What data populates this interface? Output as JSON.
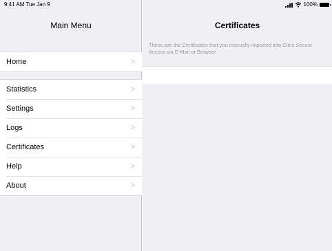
{
  "status_bar": {
    "time": "9:41 AM",
    "date": "Tue Jan 9",
    "wifi_icon": "wifi-icon",
    "battery": "100%"
  },
  "master": {
    "title": "Main Menu",
    "groups": [
      {
        "items": [
          {
            "label": "Home",
            "chevron": ">"
          }
        ]
      },
      {
        "items": [
          {
            "label": "Statistics",
            "chevron": ">"
          },
          {
            "label": "Settings",
            "chevron": ">"
          },
          {
            "label": "Logs",
            "chevron": ">"
          },
          {
            "label": "Certificates",
            "chevron": ">"
          },
          {
            "label": "Help",
            "chevron": ">"
          },
          {
            "label": "About",
            "chevron": ">"
          }
        ]
      }
    ]
  },
  "detail": {
    "title": "Certificates",
    "description": "These are the Certificates that you manually imported into Citrix Secure Access via E-Mail or Browser"
  },
  "colors": {
    "background": "#efeff4",
    "cell": "#ffffff",
    "separator": "#d8d8dc",
    "secondary_text": "#9a9aa0"
  }
}
